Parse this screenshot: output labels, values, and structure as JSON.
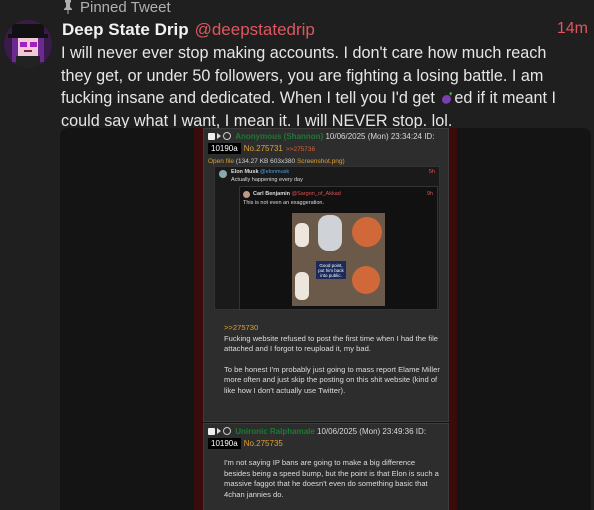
{
  "pinned_label": "Pinned Tweet",
  "tweet": {
    "display_name": "Deep State Drip",
    "handle": "@deepstatedrip",
    "time": "14m",
    "text_before": "I will never ever stop making accounts. I don't care how much reach they get, or under 50 followers, you are fighting a losing battle. I am fucking insane and dedicated. When I tell you I'd get ",
    "text_after": "ed if it meant I could say what I want, I mean it. I will NEVER stop. lol.",
    "emoji": "eggplant-emoji"
  },
  "media": {
    "post1": {
      "name": "Anonymous (Shannon)",
      "datetime": "10/06/2025 (Mon) 23:34:24 ID:",
      "id": "10190a",
      "no": "No.275731",
      "backlink": ">>275736",
      "file_link": "Open file",
      "file_meta": "(134.27 KB 603x380",
      "file_name": "Screenshot.png)",
      "embed": {
        "outer_name": "Elon Musk",
        "outer_handle": "@elonmusk",
        "outer_time": "5h",
        "outer_text": "Actually happening every day",
        "inner_name": "Carl Benjamin",
        "inner_handle": "@Sargon_of_Akkad",
        "inner_time": "9h",
        "inner_text": "This is not even an exaggeration.",
        "comic_text_1": "Good point, put him back into public."
      },
      "quote": ">>275730",
      "body_1": "Fucking website refused to post the first time when I had the file attached and I forgot to reupload it, my bad.",
      "body_2": "To be honest I'm probably just going to mass report Elame Miller more often and just skip the posting on this shit website (kind of like how I don't actually use Twitter)."
    },
    "post2": {
      "name": "Unironic Ralphamale",
      "datetime": "10/06/2025 (Mon) 23:49:36 ID:",
      "id": "10190a",
      "no": "No.275735",
      "body": "I'm not saying IP bans are going to make a big difference besides being a speed bump, but the point is that Elon is such a massive faggot that he doesn't even do something basic that 4chan jannies do."
    }
  },
  "colors": {
    "accent": "#e0565f",
    "background": "#1f1f1f"
  }
}
